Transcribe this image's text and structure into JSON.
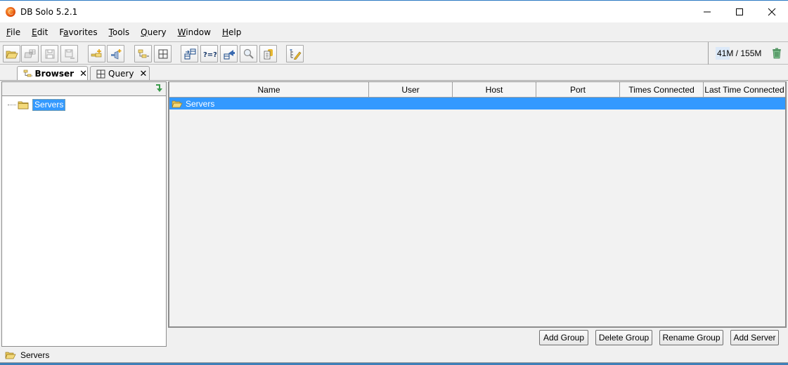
{
  "window": {
    "title": "DB Solo  5.2.1",
    "controls": [
      "minimize",
      "maximize",
      "close"
    ]
  },
  "menu": [
    {
      "label": "File",
      "mnemonic": "F",
      "rest": "ile"
    },
    {
      "label": "Edit",
      "mnemonic": "E",
      "rest": "dit"
    },
    {
      "label": "Favorites",
      "pre": "F",
      "mnemonic": "a",
      "rest": "vorites"
    },
    {
      "label": "Tools",
      "mnemonic": "T",
      "rest": "ools"
    },
    {
      "label": "Query",
      "mnemonic": "Q",
      "rest": "uery"
    },
    {
      "label": "Window",
      "mnemonic": "W",
      "rest": "indow"
    },
    {
      "label": "Help",
      "mnemonic": "H",
      "rest": "elp"
    }
  ],
  "toolbar": {
    "buttons": [
      {
        "icon": "open-folder-icon",
        "enabled": true
      },
      {
        "icon": "open-remote-icon",
        "enabled": false
      },
      {
        "icon": "save-icon",
        "enabled": false
      },
      {
        "icon": "save-as-icon",
        "enabled": false
      },
      {
        "icon": "add-server-icon",
        "enabled": true
      },
      {
        "icon": "connect-icon",
        "enabled": true
      },
      {
        "icon": "browser-tree-icon",
        "enabled": true
      },
      {
        "icon": "query-grid-icon",
        "enabled": true
      },
      {
        "icon": "compare-schema-icon",
        "enabled": true
      },
      {
        "icon": "compare-data-icon",
        "enabled": true
      },
      {
        "icon": "migrate-icon",
        "enabled": true
      },
      {
        "icon": "search-icon",
        "enabled": true
      },
      {
        "icon": "report-icon",
        "enabled": true
      },
      {
        "icon": "edit-tree-icon",
        "enabled": true
      }
    ],
    "memory": "41M / 155M",
    "memory_used_fraction": 0.26
  },
  "tabs": [
    {
      "label": "Browser",
      "active": true,
      "icon": "browser-tree-icon"
    },
    {
      "label": "Query",
      "active": false,
      "icon": "query-grid-icon"
    }
  ],
  "tree": {
    "root": "Servers"
  },
  "table": {
    "columns": [
      "Name",
      "User",
      "Host",
      "Port",
      "Times Connected",
      "Last Time Connected"
    ],
    "rows": [
      {
        "name": "Servers",
        "user": "",
        "host": "",
        "port": "",
        "times_connected": "",
        "last_time_connected": "",
        "selected": true
      }
    ]
  },
  "actions": {
    "add_group": "Add Group",
    "delete_group": "Delete Group",
    "rename_group": "Rename Group",
    "add_server": "Add Server"
  },
  "status": {
    "text": "Servers"
  },
  "colors": {
    "selection": "#3399ff",
    "folder": "#e8c95a",
    "accent_border": "#2b79c2"
  }
}
